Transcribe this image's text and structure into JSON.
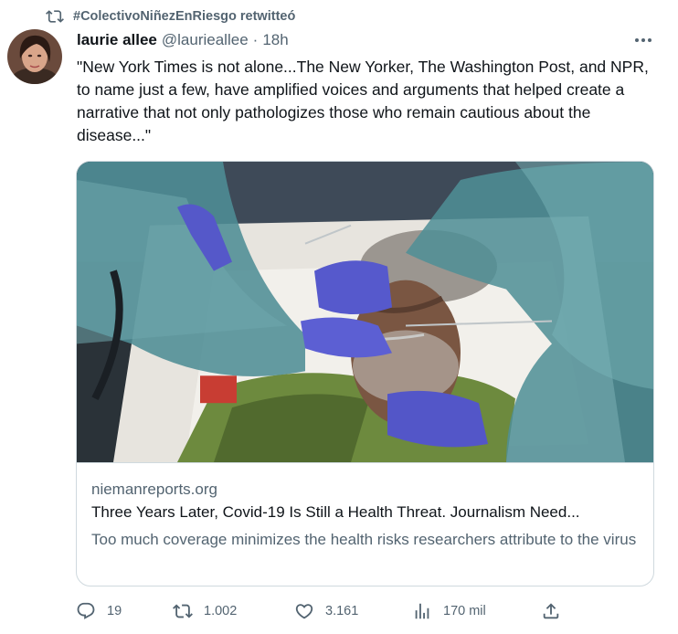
{
  "retweet": {
    "icon": "retweet-icon",
    "text": "#ColectivoNiñezEnRiesgo retwitteó"
  },
  "tweet": {
    "author_name": "laurie allee",
    "handle": "@laurieallee",
    "separator": "·",
    "time": "18h",
    "more_icon": "more-icon",
    "text": "\"New York Times is not alone...The New Yorker, The Washington Post, and NPR, to name just a few, have amplified voices and arguments that helped create a narrative that not only pathologizes those who remain cautious about the disease...\""
  },
  "card": {
    "domain": "niemanreports.org",
    "title": "Three Years Later, Covid-19 Is Still a Health Threat. Journalism Need...",
    "description": "Too much coverage minimizes the health risks researchers attribute to the virus"
  },
  "actions": {
    "reply": {
      "icon": "reply-icon",
      "count": "19"
    },
    "retweet": {
      "icon": "retweet-icon",
      "count": "1.002"
    },
    "like": {
      "icon": "heart-icon",
      "count": "3.161"
    },
    "views": {
      "icon": "views-icon",
      "count": "170 mil"
    },
    "share": {
      "icon": "share-icon"
    }
  },
  "colors": {
    "text": "#0f1419",
    "secondary": "#536471",
    "border": "#cfd9de"
  }
}
